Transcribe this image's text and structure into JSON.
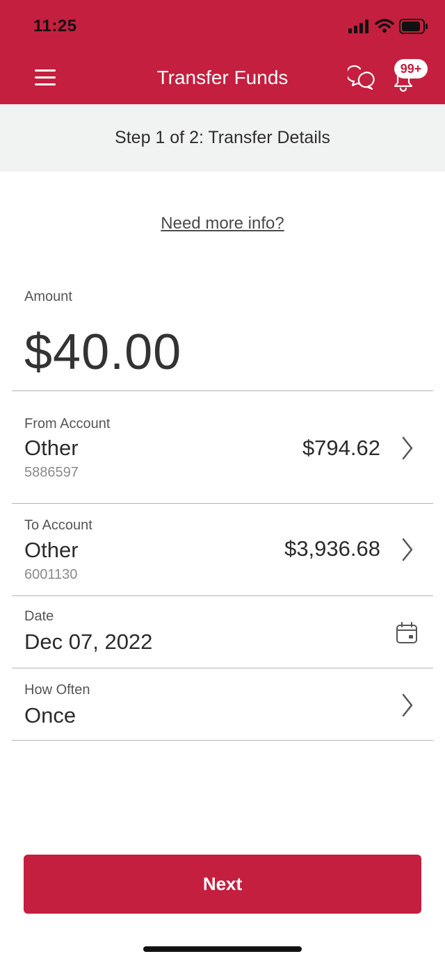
{
  "status_bar": {
    "time": "11:25"
  },
  "header": {
    "title": "Transfer Funds",
    "notification_badge": "99+",
    "bar_color": "#c41f3e"
  },
  "step": {
    "text": "Step 1 of 2: Transfer Details"
  },
  "info_link": {
    "label": "Need more info?"
  },
  "amount": {
    "label": "Amount",
    "value": "$40.00"
  },
  "from_account": {
    "label": "From Account",
    "name": "Other",
    "number": "5886597",
    "balance": "$794.62"
  },
  "to_account": {
    "label": "To Account",
    "name": "Other",
    "number": "6001130",
    "balance": "$3,936.68"
  },
  "date": {
    "label": "Date",
    "value": "Dec 07, 2022"
  },
  "frequency": {
    "label": "How Often",
    "value": "Once"
  },
  "next_button": {
    "label": "Next",
    "color": "#c41f3e"
  },
  "icons": [
    "menu-icon",
    "chat-icon",
    "bell-icon",
    "chevron-right-icon",
    "calendar-icon",
    "signal-icon",
    "wifi-icon",
    "battery-icon"
  ]
}
